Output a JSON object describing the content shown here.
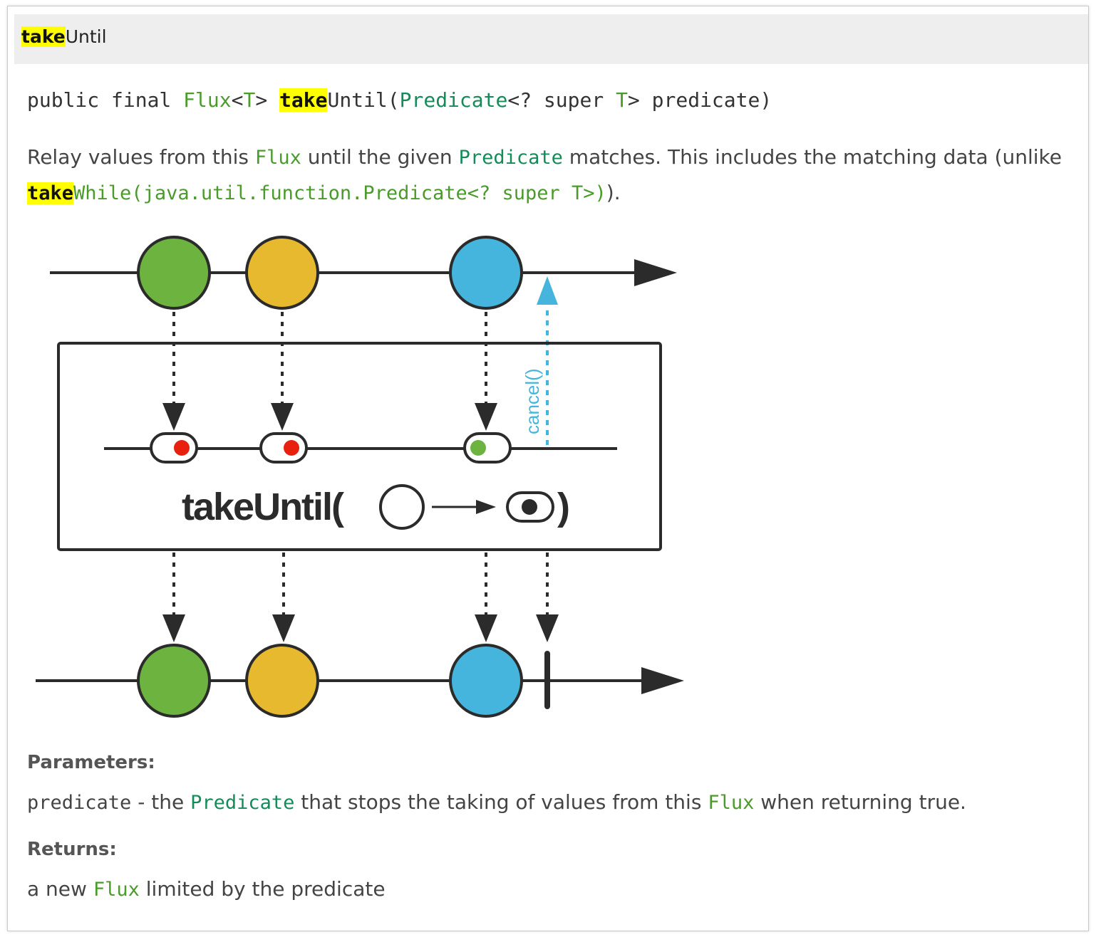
{
  "header": {
    "title_highlight": "take",
    "title_rest": "Until"
  },
  "signature": {
    "modifiers": "public final ",
    "return_type": "Flux",
    "lt": "<",
    "type_param": "T",
    "gt": "> ",
    "name_highlight": "take",
    "name_rest": "Until(",
    "param_type": "Predicate",
    "param_generic": "<? super ",
    "param_generic_type": "T",
    "param_end": "> predicate)"
  },
  "description": {
    "part1": "Relay values from this ",
    "flux": "Flux",
    "part2": " until the given ",
    "predicate": "Predicate",
    "part3": " matches. This includes the matching data (unlike ",
    "link_highlight": "take",
    "link_rest": "While(java.util.function.Predicate<? super T>)",
    "part4": ")."
  },
  "diagram": {
    "operator_label": "takeUntil(",
    "closing_paren": ")",
    "cancel_label": "cancel()",
    "colors": {
      "green": "#6db33f",
      "yellow": "#e6b92e",
      "blue": "#45b5de",
      "red_dot": "#e8210f",
      "green_dot": "#6db33f",
      "cancel": "#45b5de",
      "line": "#2b2b2b"
    }
  },
  "parameters": {
    "label": "Parameters:",
    "name": "predicate",
    "dash": " - the ",
    "type": "Predicate",
    "text": " that stops the taking of values from this ",
    "flux": "Flux",
    "text2": " when returning true."
  },
  "returns": {
    "label": "Returns:",
    "part1": "a new ",
    "flux": "Flux",
    "part2": " limited by the predicate"
  }
}
